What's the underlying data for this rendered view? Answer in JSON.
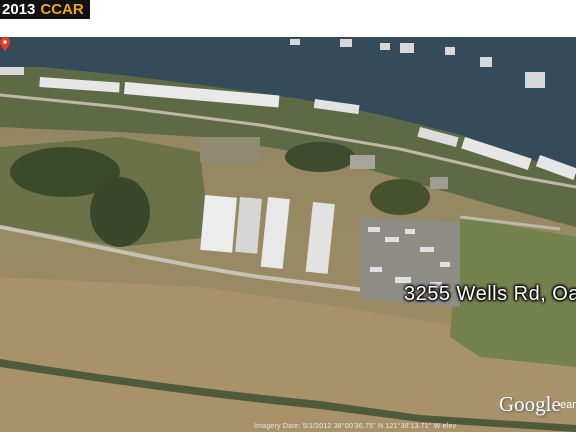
{
  "watermark": {
    "year": "2013",
    "brand": "CCAR",
    "brand_color": "#f0a418"
  },
  "map": {
    "map_type": "satellite",
    "address_label": "3255 Wells Rd, Oa",
    "pin_color": "#e83a2a",
    "google_logo": "Google",
    "logo_extra": "eart",
    "imagery_footer": "Imagery Date: 5/1/2012    38°00'36.75\" N 121°38'13.71\" W    elev"
  },
  "colors": {
    "water": "#354b5a",
    "field": "#9a8a62",
    "grass": "#6f7e4c"
  }
}
